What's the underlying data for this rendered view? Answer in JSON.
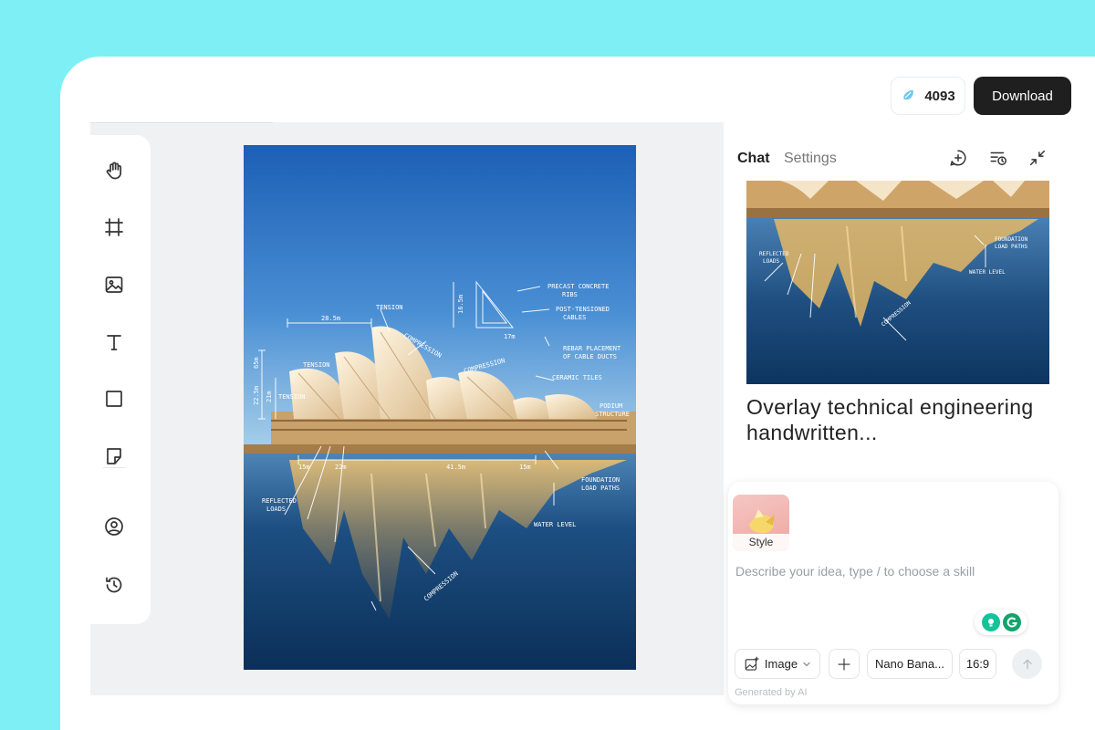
{
  "header": {
    "credits": "4093",
    "download_label": "Download"
  },
  "toolbar": {
    "tools": [
      {
        "name": "hand-icon"
      },
      {
        "name": "frame-icon"
      },
      {
        "name": "image-icon"
      },
      {
        "name": "text-icon"
      },
      {
        "name": "rectangle-icon"
      },
      {
        "name": "sticky-note-icon"
      },
      {
        "name": "user-circle-icon"
      },
      {
        "name": "history-icon"
      }
    ]
  },
  "image_annotations": {
    "tension_top": "TENSION",
    "compression_top": "COMPRESSION",
    "precast": [
      "PRECAST CONCRETE",
      "RIBS"
    ],
    "post_tensioned": [
      "POST-TENSIONED",
      "CABLES"
    ],
    "rebar": [
      "REBAR PLACEMENT",
      "OF CABLE DUCTS"
    ],
    "ceramic": "CERAMIC TILES",
    "podium": [
      "PODIUM",
      "STRUCTURE"
    ],
    "compression_mid": "COMPRESSION",
    "tension_left": "TENSION",
    "tension_left2": "TENSION",
    "reflected": [
      "REFLECTED",
      "LOADS"
    ],
    "foundation": [
      "FOUNDATION",
      "LOAD PATHS"
    ],
    "water": "WATER LEVEL",
    "compression_low": "COMPRESSION",
    "dim_top": "28.5m",
    "dim_section": "16.5m",
    "dim_17": "17m",
    "dim_65": "65m",
    "dim_225": "22.5m",
    "dim_21": "21m",
    "dim_15a": "15m",
    "dim_22": "22m",
    "dim_415": "41.5m",
    "dim_15b": "15m"
  },
  "chat_panel": {
    "tabs": [
      "Chat",
      "Settings"
    ],
    "thumb_annotations": {
      "reflected": [
        "REFLECTED",
        "LOADS"
      ],
      "foundation": [
        "FOUNDATION",
        "LOAD PATHS"
      ],
      "water": "WATER LEVEL",
      "compression": "COMPRESSION"
    },
    "prompt_preview": "Overlay technical engineering handwritten..."
  },
  "composer": {
    "style_label": "Style",
    "placeholder": "Describe your idea, type / to choose a skill",
    "mode_label": "Image",
    "model_label": "Nano Bana...",
    "ratio_label": "16:9",
    "footnote": "Generated by AI"
  },
  "colors": {
    "background": "#7ef0f5",
    "sky_top": "#1c5fb5",
    "sky_bottom": "#a8d0ea",
    "water": "#0f3a66",
    "sail": "#f4e5c8",
    "dark_button": "#1f1f1f"
  }
}
